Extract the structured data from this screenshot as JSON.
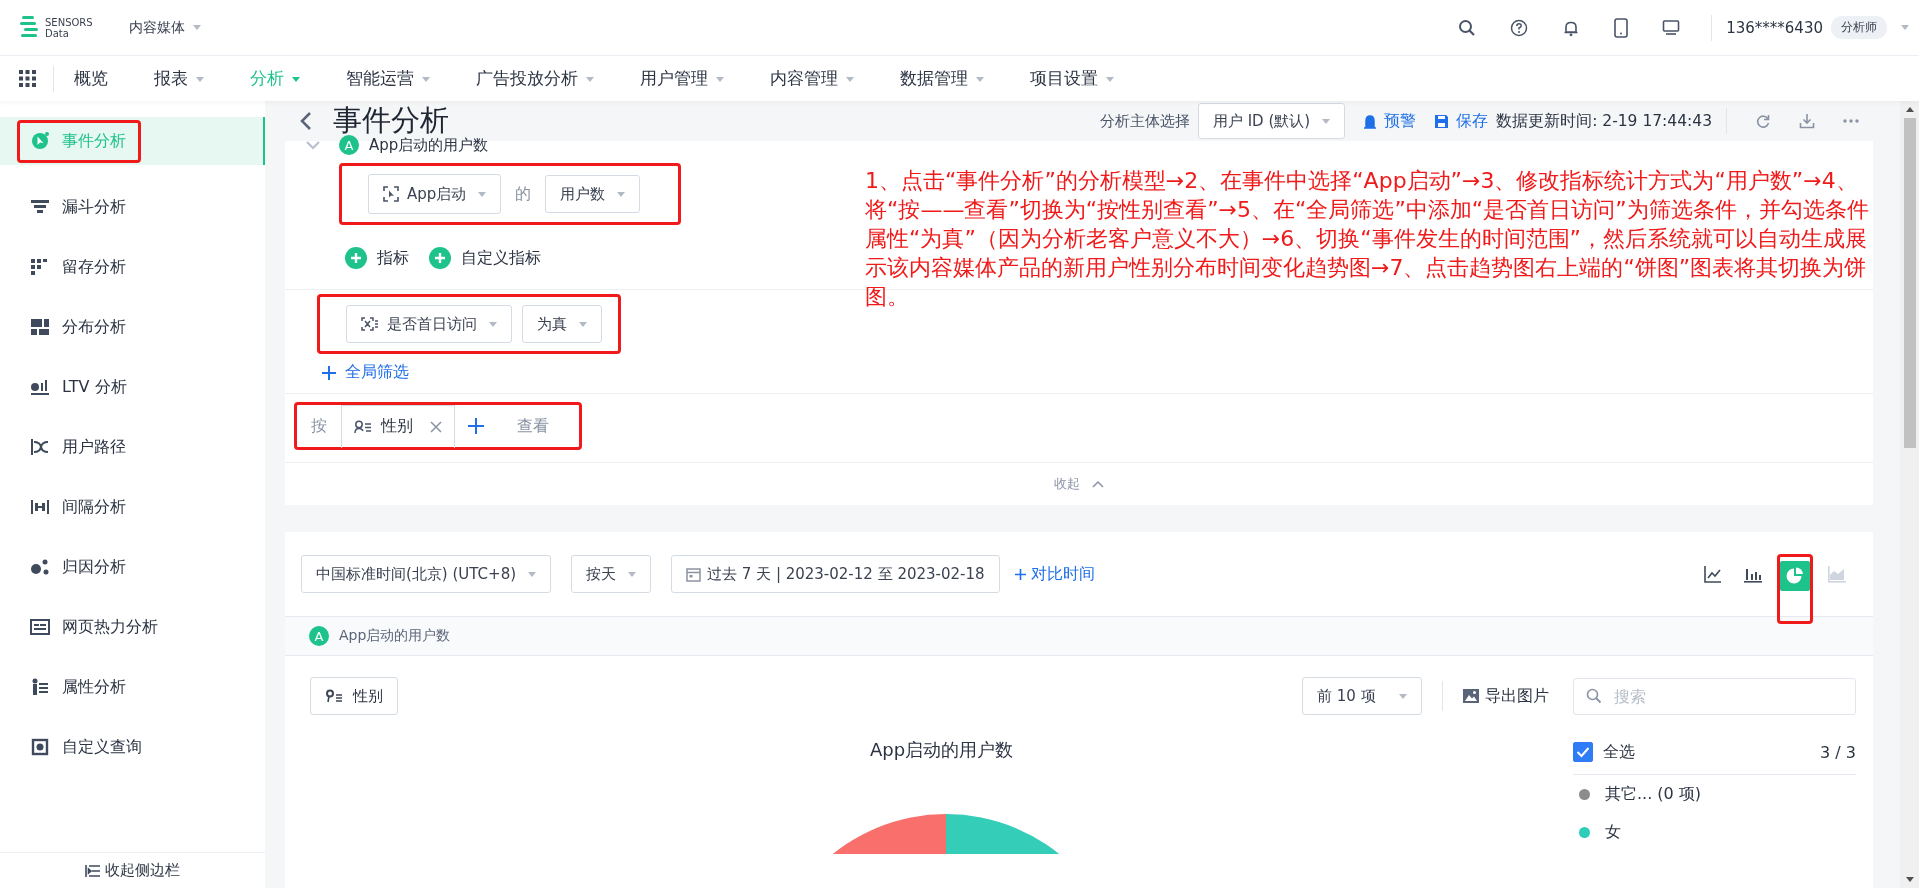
{
  "brand": {
    "line1": "SENSORS",
    "line2": "Data"
  },
  "project": "内容媒体",
  "user": {
    "phone": "136****6430",
    "role": "分析师"
  },
  "nav": [
    {
      "label": "概览",
      "selected": false,
      "has_menu": false
    },
    {
      "label": "报表",
      "selected": false,
      "has_menu": true
    },
    {
      "label": "分析",
      "selected": true,
      "has_menu": true
    },
    {
      "label": "智能运营",
      "selected": false,
      "has_menu": true
    },
    {
      "label": "广告投放分析",
      "selected": false,
      "has_menu": true
    },
    {
      "label": "用户管理",
      "selected": false,
      "has_menu": true
    },
    {
      "label": "内容管理",
      "selected": false,
      "has_menu": true
    },
    {
      "label": "数据管理",
      "selected": false,
      "has_menu": true
    },
    {
      "label": "项目设置",
      "selected": false,
      "has_menu": true
    }
  ],
  "sidebar": {
    "items": [
      {
        "label": "事件分析",
        "selected": true,
        "highlighted": true
      },
      {
        "label": "漏斗分析",
        "selected": false,
        "highlighted": false
      },
      {
        "label": "留存分析",
        "selected": false,
        "highlighted": false
      },
      {
        "label": "分布分析",
        "selected": false,
        "highlighted": false
      },
      {
        "label": "LTV 分析",
        "selected": false,
        "highlighted": false
      },
      {
        "label": "用户路径",
        "selected": false,
        "highlighted": false
      },
      {
        "label": "间隔分析",
        "selected": false,
        "highlighted": false
      },
      {
        "label": "归因分析",
        "selected": false,
        "highlighted": false
      },
      {
        "label": "网页热力分析",
        "selected": false,
        "highlighted": false
      },
      {
        "label": "属性分析",
        "selected": false,
        "highlighted": false
      },
      {
        "label": "自定义查询",
        "selected": false,
        "highlighted": false
      }
    ],
    "collapse": "收起侧边栏"
  },
  "header": {
    "title": "事件分析",
    "subject_label": "分析主体选择",
    "subject_value": "用户 ID (默认)",
    "alert": "预警",
    "save": "保存",
    "updated": "数据更新时间: 2-19 17:44:43"
  },
  "query": {
    "badge": "A",
    "metric_title": "App启动的用户数",
    "event": "App启动",
    "of": "的",
    "measure": "用户数",
    "add_metric": "指标",
    "add_custom": "自定义指标",
    "filter_property": "是否首日访问",
    "filter_op": "为真",
    "add_filter": "全局筛选",
    "group_prefix": "按",
    "group_property": "性别",
    "group_suffix": "查看",
    "collapse": "收起"
  },
  "annotation": "1、点击“事件分析”的分析模型→2、在事件中选择“App启动”→3、修改指标统计方式为“用户数”→4、将“按——查看”切换为“按性别查看”→5、在“全局筛选”中添加“是否首日访问”为筛选条件，并勾选条件属性“为真”（因为分析老客户意义不大）→6、切换“事件发生的时间范围”，然后系统就可以自动生成展示该内容媒体产品的新用户性别分布时间变化趋势图→7、点击趋势图右上端的“饼图”图表将其切换为饼图。",
  "toolbar": {
    "timezone": "中国标准时间(北京) (UTC+8)",
    "granularity": "按天",
    "date_range": "过去 7 天 | 2023-02-12 至 2023-02-18",
    "compare": "对比时间",
    "chart_types": [
      {
        "kind": "line",
        "selected": false,
        "disabled": false,
        "highlighted": false
      },
      {
        "kind": "bar",
        "selected": false,
        "disabled": false,
        "highlighted": false
      },
      {
        "kind": "pie",
        "selected": true,
        "disabled": false,
        "highlighted": true
      },
      {
        "kind": "area",
        "selected": false,
        "disabled": true,
        "highlighted": false
      }
    ]
  },
  "series_tag": {
    "badge": "A",
    "label": "App启动的用户数"
  },
  "chart": {
    "group_chip": "性别",
    "top_n": "前 10 项",
    "export": "导出图片",
    "search_placeholder": "搜索",
    "title": "App启动的用户数",
    "select_all": {
      "label": "全选",
      "checked": true
    },
    "count": "3 / 3",
    "legend": [
      {
        "label": "其它... (0 项)",
        "color": "#8c8c8c"
      },
      {
        "label": "女",
        "color": "#2ecdb9"
      }
    ]
  }
}
